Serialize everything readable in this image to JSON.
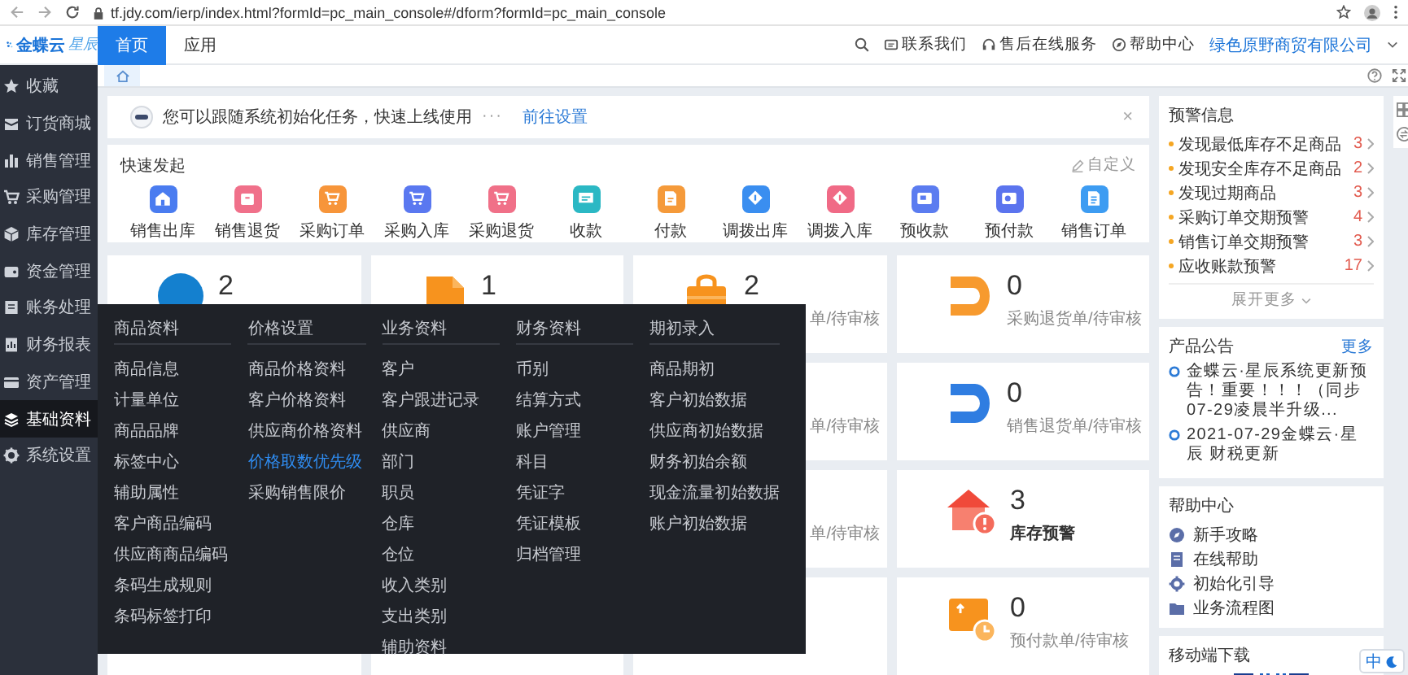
{
  "browser": {
    "url": "tf.jdy.com/ierp/index.html?formId=pc_main_console#/dform?formId=pc_main_console"
  },
  "header": {
    "logo": "金蝶云",
    "logo_sub": "星辰",
    "tabs": [
      {
        "label": "首页",
        "selected": true
      },
      {
        "label": "应用",
        "selected": false
      }
    ],
    "links": [
      "联系我们",
      "售后在线服务",
      "帮助中心"
    ],
    "company": "绿色原野商贸有限公司"
  },
  "sidebar": [
    {
      "label": "收藏",
      "selected": false
    },
    {
      "label": "订货商城",
      "selected": false
    },
    {
      "label": "销售管理",
      "selected": false
    },
    {
      "label": "采购管理",
      "selected": false
    },
    {
      "label": "库存管理",
      "selected": false
    },
    {
      "label": "资金管理",
      "selected": false
    },
    {
      "label": "账务处理",
      "selected": false
    },
    {
      "label": "财务报表",
      "selected": false
    },
    {
      "label": "资产管理",
      "selected": false
    },
    {
      "label": "基础资料",
      "selected": true
    },
    {
      "label": "系统设置",
      "selected": false
    }
  ],
  "notice": {
    "text": "您可以跟随系统初始化任务，快速上线使用",
    "dots": "···",
    "link": "前往设置",
    "close": "×"
  },
  "quick_launch": {
    "title": "快速发起",
    "customize": "自定义",
    "items": [
      {
        "label": "销售出库",
        "color": "#4a7cf0"
      },
      {
        "label": "销售退货",
        "color": "#f0708a"
      },
      {
        "label": "采购订单",
        "color": "#f7953a"
      },
      {
        "label": "采购入库",
        "color": "#5a78f0"
      },
      {
        "label": "采购退货",
        "color": "#f07088"
      },
      {
        "label": "收款",
        "color": "#2bb8c4"
      },
      {
        "label": "付款",
        "color": "#f59a3a"
      },
      {
        "label": "调拨出库",
        "color": "#3a8ef0"
      },
      {
        "label": "调拨入库",
        "color": "#f06a86"
      },
      {
        "label": "预收款",
        "color": "#5b7cf0"
      },
      {
        "label": "预付款",
        "color": "#5b74ee"
      },
      {
        "label": "销售订单",
        "color": "#3d9cf2"
      }
    ]
  },
  "cards": [
    [
      {
        "kind": "circle",
        "number": "2"
      }
    ],
    [
      {
        "kind": "document",
        "number": "1"
      }
    ],
    [
      {
        "kind": "bag",
        "number": "2",
        "label": "单/待审核"
      },
      {
        "label": "单/待审核"
      },
      {
        "label": "单/待审核"
      }
    ],
    [
      {
        "kind": "return",
        "color": "#f79a2e",
        "number": "0",
        "label": "采购退货单/待审核",
        "bold": false
      },
      {
        "kind": "return",
        "color": "#2f7de1",
        "number": "0",
        "label": "销售退货单/待审核",
        "bold": false
      },
      {
        "kind": "warehouse",
        "number": "3",
        "label": "库存预警",
        "bold": true
      },
      {
        "kind": "prepay",
        "number": "0",
        "label": "预付款单/待审核",
        "bold": false
      }
    ]
  ],
  "mega_menu": {
    "columns": [
      {
        "title": "商品资料",
        "items": [
          {
            "label": "商品信息",
            "selected": false
          },
          {
            "label": "计量单位",
            "selected": false
          },
          {
            "label": "商品品牌",
            "selected": false
          },
          {
            "label": "标签中心",
            "selected": false
          },
          {
            "label": "辅助属性",
            "selected": false
          },
          {
            "label": "客户商品编码",
            "selected": false
          },
          {
            "label": "供应商商品编码",
            "selected": false
          },
          {
            "label": "条码生成规则",
            "selected": false
          },
          {
            "label": "条码标签打印",
            "selected": false
          }
        ]
      },
      {
        "title": "价格设置",
        "items": [
          {
            "label": "商品价格资料",
            "selected": false
          },
          {
            "label": "客户价格资料",
            "selected": false
          },
          {
            "label": "供应商价格资料",
            "selected": false
          },
          {
            "label": "价格取数优先级",
            "selected": true
          },
          {
            "label": "采购销售限价",
            "selected": false
          }
        ]
      },
      {
        "title": "业务资料",
        "items": [
          {
            "label": "客户",
            "selected": false
          },
          {
            "label": "客户跟进记录",
            "selected": false
          },
          {
            "label": "供应商",
            "selected": false
          },
          {
            "label": "部门",
            "selected": false
          },
          {
            "label": "职员",
            "selected": false
          },
          {
            "label": "仓库",
            "selected": false
          },
          {
            "label": "仓位",
            "selected": false
          },
          {
            "label": "收入类别",
            "selected": false
          },
          {
            "label": "支出类别",
            "selected": false
          },
          {
            "label": "辅助资料",
            "selected": false
          }
        ]
      },
      {
        "title": "财务资料",
        "items": [
          {
            "label": "币别",
            "selected": false
          },
          {
            "label": "结算方式",
            "selected": false
          },
          {
            "label": "账户管理",
            "selected": false
          },
          {
            "label": "科目",
            "selected": false
          },
          {
            "label": "凭证字",
            "selected": false
          },
          {
            "label": "凭证模板",
            "selected": false
          },
          {
            "label": "归档管理",
            "selected": false
          }
        ]
      },
      {
        "title": "期初录入",
        "items": [
          {
            "label": "商品期初",
            "selected": false
          },
          {
            "label": "客户初始数据",
            "selected": false
          },
          {
            "label": "供应商初始数据",
            "selected": false
          },
          {
            "label": "财务初始余额",
            "selected": false
          },
          {
            "label": "现金流量初始数据",
            "selected": false
          },
          {
            "label": "账户初始数据",
            "selected": false
          }
        ]
      }
    ]
  },
  "right_panel": {
    "alerts": {
      "title": "预警信息",
      "items": [
        {
          "label": "发现最低库存不足商品",
          "count": "3"
        },
        {
          "label": "发现安全库存不足商品",
          "count": "2"
        },
        {
          "label": "发现过期商品",
          "count": "3"
        },
        {
          "label": "采购订单交期预警",
          "count": "4"
        },
        {
          "label": "销售订单交期预警",
          "count": "3"
        },
        {
          "label": "应收账款预警",
          "count": "17"
        }
      ],
      "more": "展开更多"
    },
    "announcements": {
      "title": "产品公告",
      "more": "更多",
      "items": [
        "金蝶云·星辰系统更新预告！重要！！！（同步07-29凌晨半升级...",
        "2021-07-29金蝶云·星辰 财税更新"
      ]
    },
    "help": {
      "title": "帮助中心",
      "items": [
        "新手攻略",
        "在线帮助",
        "初始化引导",
        "业务流程图"
      ]
    },
    "mobile": {
      "title": "移动端下载"
    }
  },
  "ime": {
    "label": "中"
  }
}
